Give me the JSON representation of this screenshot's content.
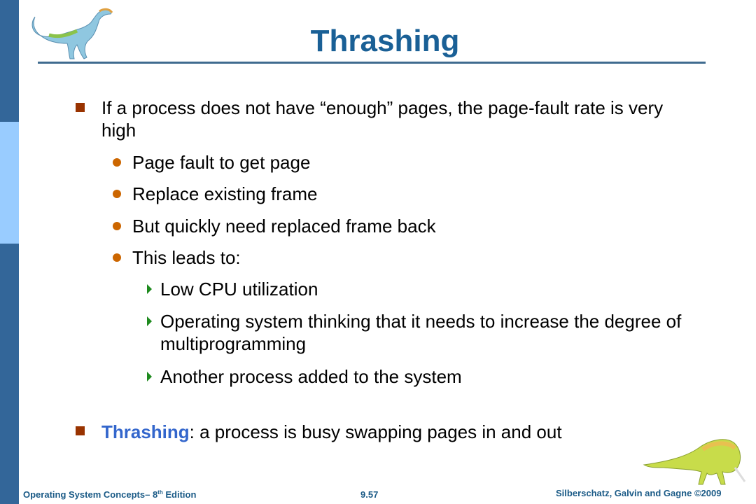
{
  "slide": {
    "title": "Thrashing",
    "bullets": [
      {
        "line1": "If a process does not have “enough” pages, the page-fault rate is very",
        "line2": "high",
        "sub": [
          "Page fault to get page",
          "Replace existing frame",
          "But quickly need replaced frame back",
          "This leads to:"
        ],
        "subsub": [
          {
            "line1": "Low CPU utilization"
          },
          {
            "line1": "Operating system thinking that it needs to increase the degree of",
            "line2": "multiprogramming"
          },
          {
            "line1": "Another process added to the system"
          }
        ]
      },
      {
        "keyword": "Thrashing",
        "rest": ": a process is busy swapping pages in and out"
      }
    ]
  },
  "footer": {
    "book_prefix": "Operating System Concepts– 8",
    "book_sup": "th",
    "book_suffix": " Edition",
    "page": "9.57",
    "copyright": "Silberschatz, Galvin and Gagne ©2009"
  },
  "colors": {
    "sidebar_dark": "#336699",
    "sidebar_light": "#99ccff",
    "title": "#1a6096",
    "bullet_l1": "#993300",
    "bullet_l2": "#cc6600",
    "bullet_l3": "#1e8a1e",
    "keyword": "#3366cc"
  }
}
